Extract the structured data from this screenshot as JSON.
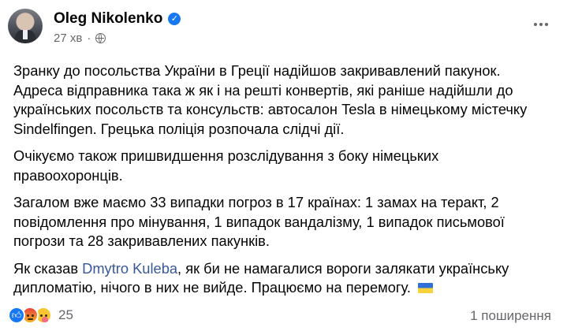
{
  "post": {
    "author": "Oleg Nikolenko",
    "time": "27 хв",
    "paragraphs": [
      "Зранку до посольства України в Греції надійшов закривавлений пакунок.\nАдреса відправника така ж як і на решті конвертів, які раніше надійшли до\nукраїнських посольств та консульств: автосалон Tesla в німецькому містечку\nSindelfingen. Грецька поліція розпочала слідчі дії.",
      "Очікуємо також пришвидшення розслідування з боку німецьких\nправоохоронців.",
      "Загалом вже маємо 33 випадки погроз в 17 країнах: 1 замах на теракт, 2\nповідомлення про мінування, 1 випадок вандалізму, 1 випадок письмової\nпогрози та 28 закривавлених пакунків."
    ],
    "last_paragraph": {
      "prefix": "Як сказав ",
      "mention": "Dmytro Kuleba",
      "suffix": ", як би не намагалися вороги залякати українську\nдипломатію, нічого в них не вийде. Працюємо на перемогу. "
    }
  },
  "footer": {
    "reaction_count": "25",
    "shares": "1 поширення"
  },
  "icons": {
    "verified": "verified-badge-icon",
    "privacy": "globe-icon",
    "more": "more-options-icon",
    "flag": "ukraine-flag-icon",
    "reactions": [
      "like-icon",
      "angry-icon",
      "care-icon"
    ]
  },
  "colors": {
    "accent": "#1877f2",
    "mention": "#385898",
    "secondary_text": "#65676b"
  }
}
